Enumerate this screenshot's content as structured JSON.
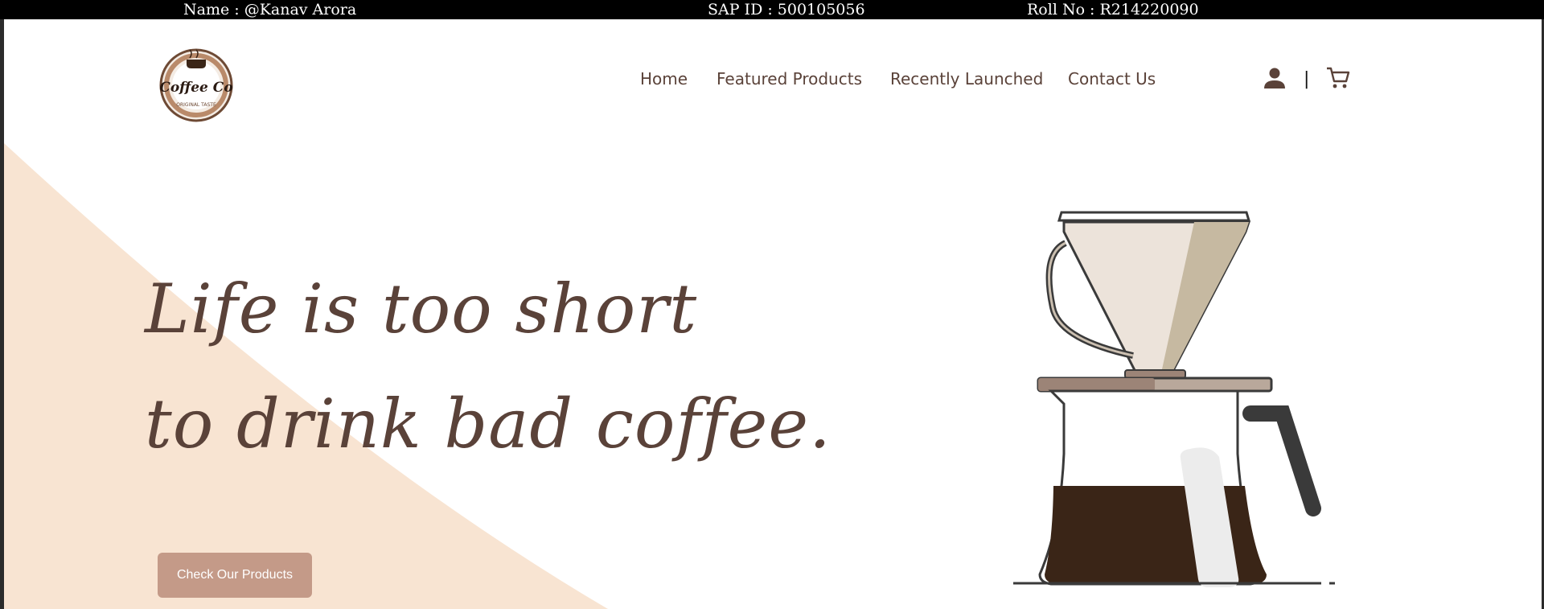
{
  "topbar": {
    "name": "Name : @Kanav Arora",
    "sap": "SAP ID : 500105056",
    "roll": "Roll No : R214220090"
  },
  "logo": {
    "text": "Coffee Co",
    "tagline": "ORIGINAL TASTE"
  },
  "nav": {
    "items": [
      "Home",
      "Featured Products",
      "Recently Launched",
      "Contact Us"
    ]
  },
  "header": {
    "separator": "|",
    "user_icon": "user-icon",
    "cart_icon": "cart-icon"
  },
  "hero": {
    "line1": "Life is too short",
    "line2": "to drink bad coffee.",
    "cta_label": "Check Our Products"
  },
  "colors": {
    "brand_brown": "#5a4239",
    "cta_bg": "#c49a88",
    "peach_bg": "#f8e4d2",
    "coffee": "#3a2517"
  }
}
